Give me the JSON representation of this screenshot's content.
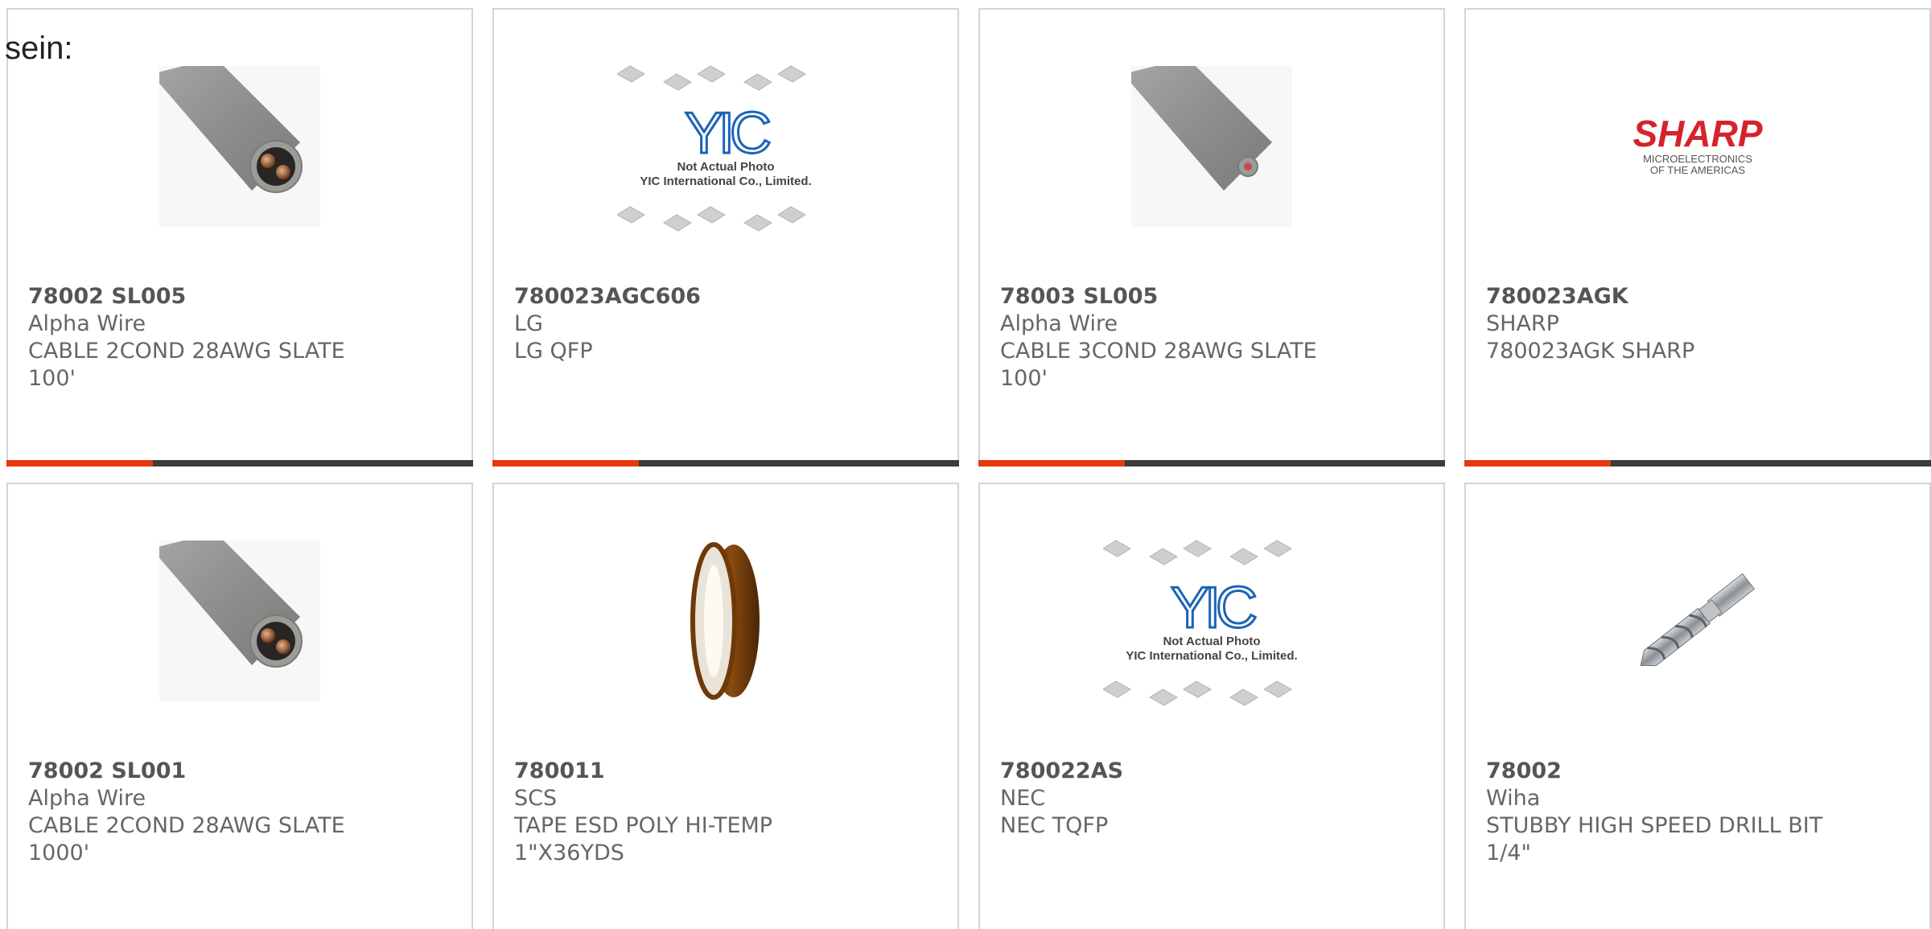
{
  "heading_fragment": "sein:",
  "colors": {
    "accent": "#e8380d",
    "bar": "#3c3c3c",
    "border": "#d4d4d4",
    "text": "#666666",
    "part_number": "#555555",
    "sharp_red": "#d6232b",
    "yic_blue": "#1b64b5"
  },
  "products": [
    {
      "part_number": "78002 SL005",
      "manufacturer": "Alpha Wire",
      "description": "CABLE 2COND 28AWG SLATE 100'",
      "image_icon": "cable-2cond-icon"
    },
    {
      "part_number": "780023AGC606",
      "manufacturer": "LG",
      "description": "LG QFP",
      "image_icon": "yic-placeholder-icon",
      "image_text": {
        "brand": "YIC",
        "line1": "Not Actual Photo",
        "line2": "YIC International Co., Limited."
      }
    },
    {
      "part_number": "78003 SL005",
      "manufacturer": "Alpha Wire",
      "description": "CABLE 3COND 28AWG SLATE 100'",
      "image_icon": "cable-3cond-icon"
    },
    {
      "part_number": "780023AGK",
      "manufacturer": "SHARP",
      "description": "780023AGK SHARP",
      "image_icon": "sharp-logo-icon",
      "image_text": {
        "brand": "SHARP",
        "line1": "MICROELECTRONICS",
        "line2": "OF THE AMERICAS"
      }
    },
    {
      "part_number": "78002 SL001",
      "manufacturer": "Alpha Wire",
      "description": "CABLE 2COND 28AWG SLATE 1000'",
      "image_icon": "cable-2cond-icon"
    },
    {
      "part_number": "780011",
      "manufacturer": "SCS",
      "description": "TAPE ESD POLY HI-TEMP 1\"X36YDS",
      "image_icon": "tape-roll-icon"
    },
    {
      "part_number": "780022AS",
      "manufacturer": "NEC",
      "description": "NEC TQFP",
      "image_icon": "yic-placeholder-icon",
      "image_text": {
        "brand": "YIC",
        "line1": "Not Actual Photo",
        "line2": "YIC International Co., Limited."
      }
    },
    {
      "part_number": "78002",
      "manufacturer": "Wiha",
      "description": "STUBBY HIGH SPEED DRILL BIT 1/4\"",
      "image_icon": "drill-bit-icon"
    }
  ]
}
